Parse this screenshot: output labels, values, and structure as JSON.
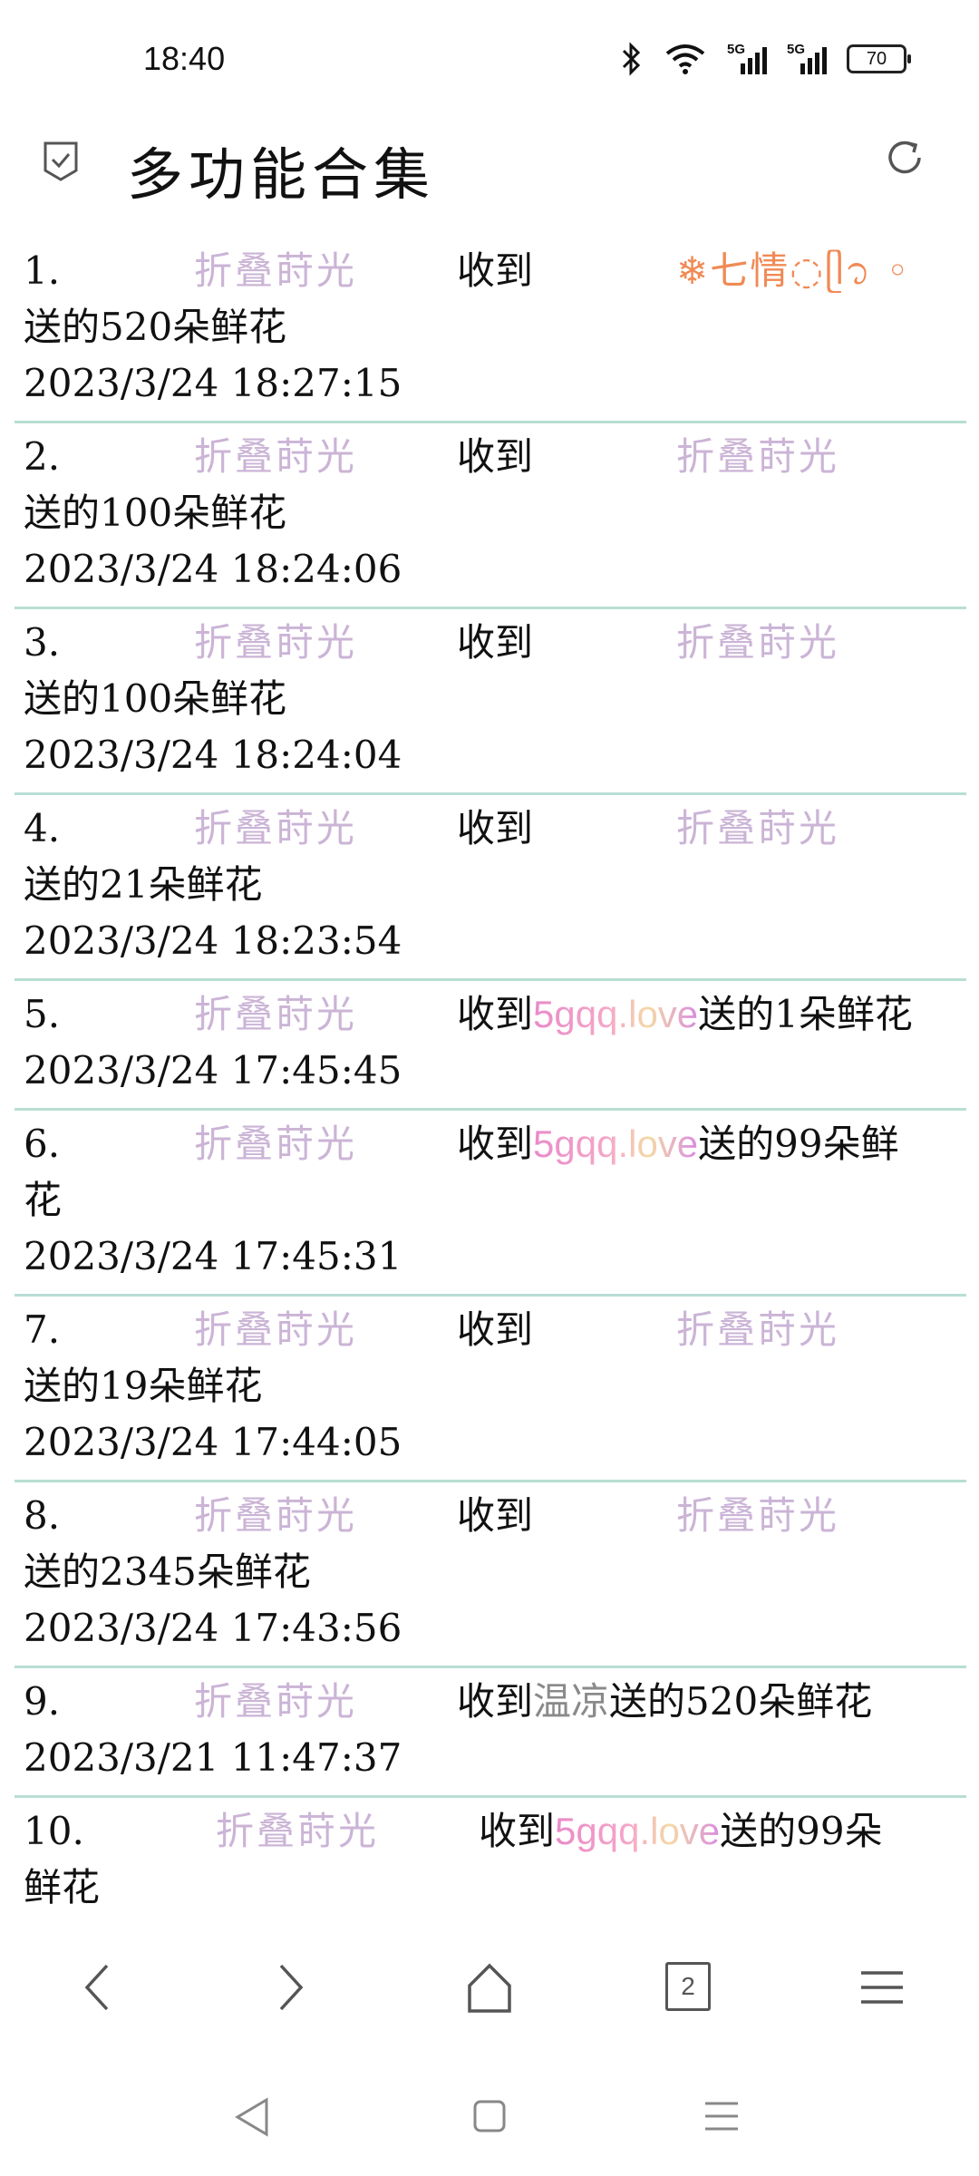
{
  "status": {
    "time": "18:40",
    "signal1_label": "5G",
    "signal2_label": "5G",
    "battery": "70"
  },
  "header": {
    "title": "多功能合集"
  },
  "records": [
    {
      "num": "1.",
      "sender": "折叠莳光",
      "recv": "收到",
      "recipient": "❄七情◌ᥫ᭡ ◦",
      "gift": "送的520朵鲜花",
      "time": "2023/3/24 18:27:15"
    },
    {
      "num": "2.",
      "sender": "折叠莳光",
      "recv": "收到",
      "recipient": "折叠莳光",
      "gift": "送的100朵鲜花",
      "time": "2023/3/24 18:24:06"
    },
    {
      "num": "3.",
      "sender": "折叠莳光",
      "recv": "收到",
      "recipient": "折叠莳光",
      "gift": "送的100朵鲜花",
      "time": "2023/3/24 18:24:04"
    },
    {
      "num": "4.",
      "sender": "折叠莳光",
      "recv": "收到",
      "recipient": "折叠莳光",
      "gift": "送的21朵鲜花",
      "time": "2023/3/24 18:23:54"
    },
    {
      "num": "5.",
      "sender": "折叠莳光",
      "recv": "收到",
      "recipient": "5gqq.love",
      "gift": "送的1朵鲜花",
      "time": "2023/3/24 17:45:45"
    },
    {
      "num": "6.",
      "sender": "折叠莳光",
      "recv": "收到",
      "recipient": "5gqq.love",
      "gift_a": "送的99朵鲜",
      "gift_b": "花",
      "time": "2023/3/24 17:45:31"
    },
    {
      "num": "7.",
      "sender": "折叠莳光",
      "recv": "收到",
      "recipient": "折叠莳光",
      "gift": "送的19朵鲜花",
      "time": "2023/3/24 17:44:05"
    },
    {
      "num": "8.",
      "sender": "折叠莳光",
      "recv": "收到",
      "recipient": "折叠莳光",
      "gift": "送的2345朵鲜花",
      "time": "2023/3/24 17:43:56"
    },
    {
      "num": "9.",
      "sender": "折叠莳光",
      "recv": "收到",
      "recipient": "温凉",
      "gift": "送的520朵鲜花",
      "time": "2023/3/21 11:47:37"
    },
    {
      "num": "10.",
      "sender": "折叠莳光",
      "recv": "收到",
      "recipient": "5gqq.love",
      "gift_a": "送的99朵",
      "gift_b": "鲜花"
    }
  ],
  "browser_nav": {
    "tab_count": "2"
  },
  "icons": [
    "check-icon",
    "refresh-icon",
    "bluetooth-icon",
    "wifi-icon",
    "back-icon",
    "forward-icon",
    "home-icon",
    "tabs-icon",
    "menu-icon"
  ]
}
